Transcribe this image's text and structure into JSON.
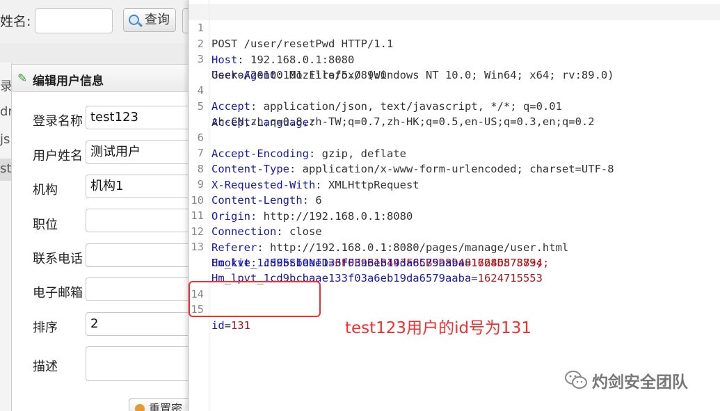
{
  "left_app": {
    "search": {
      "name_label": "姓名:",
      "query_button": "查询"
    },
    "grid_fragments": [
      "录",
      "dr",
      "js",
      "st"
    ],
    "dialog": {
      "title": "编辑用户信息",
      "fields": [
        {
          "label": "登录名称",
          "value": "test123"
        },
        {
          "label": "用户姓名",
          "value": "测试用户"
        },
        {
          "label": "机构",
          "value": "机构1"
        },
        {
          "label": "职位",
          "value": ""
        },
        {
          "label": "联系电话",
          "value": ""
        },
        {
          "label": "电子邮箱",
          "value": ""
        },
        {
          "label": "排序",
          "value": "2"
        },
        {
          "label": "描述",
          "value": ""
        }
      ],
      "reset_button": "重置密"
    }
  },
  "request": {
    "line1": "POST /user/resetPwd HTTP/1.1",
    "host_key": "Host",
    "host_val": "192.168.0.1:8080",
    "ua_key": "User-Agent",
    "ua_val": "Mozilla/5.0 (Windows NT 10.0; Win64; x64; rv:89.0)",
    "ua_cont": "Gecko/20100101 Firefox/89.0",
    "accept_key": "Accept",
    "accept_val": "application/json, text/javascript, */*; q=0.01",
    "lang_key": "Accept-Language",
    "lang_cont": "zh-CN,zh;q=0.8,zh-TW;q=0.7,zh-HK;q=0.5,en-US;q=0.3,en;q=0.2",
    "enc_key": "Accept-Encoding",
    "enc_val": "gzip, deflate",
    "ctype_key": "Content-Type",
    "ctype_val": "application/x-www-form-urlencoded; charset=UTF-8",
    "xrw_key": "X-Requested-With",
    "xrw_val": "XMLHttpRequest",
    "clen_key": "Content-Length",
    "clen_val": "6",
    "origin_key": "Origin",
    "origin_val": "http://192.168.0.1:8080",
    "conn_key": "Connection",
    "conn_val": "close",
    "ref_key": "Referer",
    "ref_val": "http://192.168.0.1:8080/pages/manage/user.html",
    "cookie_key": "Cookie",
    "cookie1_name": "JSESSIONID",
    "cookie1_val": "6FFE9B1B443F8CB5D89481768D578794;",
    "cookie2_name": "Hm_lvt_1cd9bcbaae133f03a6eb19da6579aaba",
    "cookie2_val": "1624687383;",
    "cookie3_name": "Hm_lpvt_1cd9bcbaae133f03a6eb19da6579aaba",
    "cookie3_val": "1624715553",
    "body_name": "id",
    "body_val": "131",
    "line_numbers": [
      "1",
      "2",
      "3",
      "4",
      "5",
      "6",
      "7",
      "8",
      "9",
      "10",
      "11",
      "12",
      "13",
      "14",
      "15"
    ]
  },
  "annotation": "test123用户的id号为131",
  "watermark": "灼剑安全团队",
  "colors": {
    "key": "#1717b3",
    "red_value": "#b8121b",
    "annotation": "#ff2a2a"
  }
}
